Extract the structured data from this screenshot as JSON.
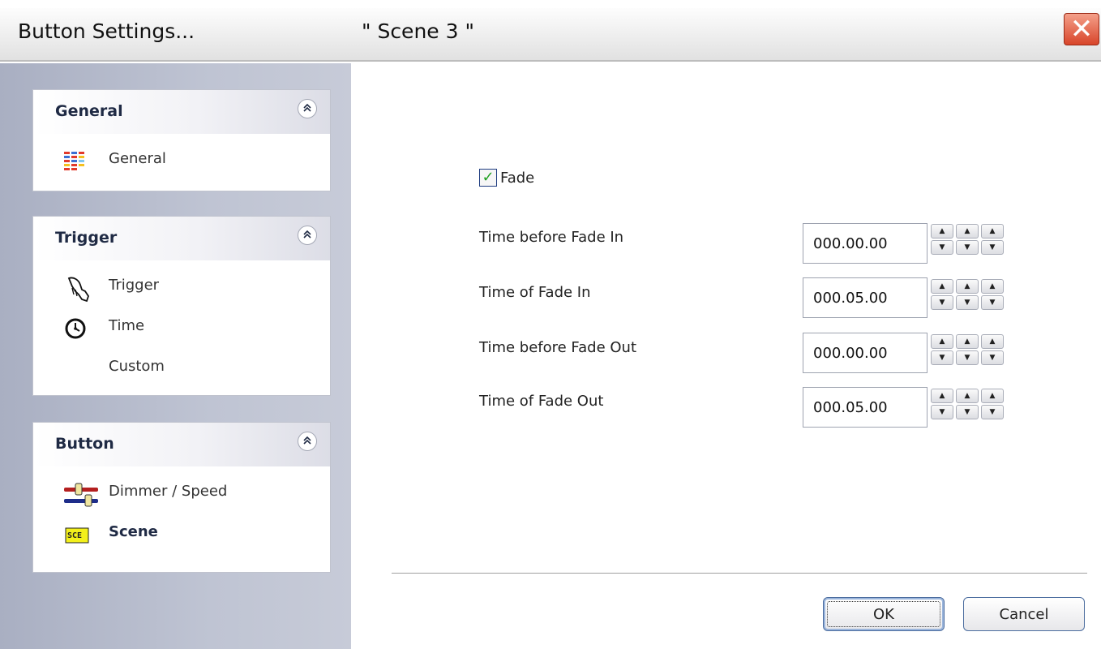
{
  "window": {
    "title": "Button  Settings...",
    "scene_title": "\" Scene 3 \"",
    "close_glyph": "✕"
  },
  "sidebar": {
    "panels": [
      {
        "header": "General",
        "collapse_glyph": "⌃",
        "items": [
          {
            "label": "General",
            "icon": "general-grid-icon"
          }
        ]
      },
      {
        "header": "Trigger",
        "collapse_glyph": "⌃",
        "items": [
          {
            "label": "Trigger",
            "icon": "hand-trigger-icon"
          },
          {
            "label": "Time",
            "icon": "clock-icon"
          },
          {
            "label": "Custom",
            "icon": ""
          }
        ]
      },
      {
        "header": "Button",
        "collapse_glyph": "⌃",
        "items": [
          {
            "label": "Dimmer / Speed",
            "icon": "dimmer-slider-icon"
          },
          {
            "label": "Scene",
            "icon": "scene-icon",
            "selected": true,
            "icon_text": "SCE"
          }
        ]
      }
    ]
  },
  "fade": {
    "label": "Fade",
    "checked": true,
    "check_glyph": "✓"
  },
  "timings": [
    {
      "label": "Time before Fade In",
      "value": "000.00.00"
    },
    {
      "label": "Time of Fade In",
      "value": "000.05.00"
    },
    {
      "label": "Time before Fade Out",
      "value": "000.00.00"
    },
    {
      "label": "Time of Fade Out",
      "value": "000.05.00"
    }
  ],
  "spin_glyphs": {
    "up": "▲",
    "down": "▼"
  },
  "buttons": {
    "ok": "OK",
    "cancel": "Cancel"
  },
  "colors": {
    "close_red": "#d8452a",
    "sidebar_bg": "#b6bbcb",
    "check_green": "#21a121",
    "scene_icon_yellow": "#f3f01b"
  }
}
